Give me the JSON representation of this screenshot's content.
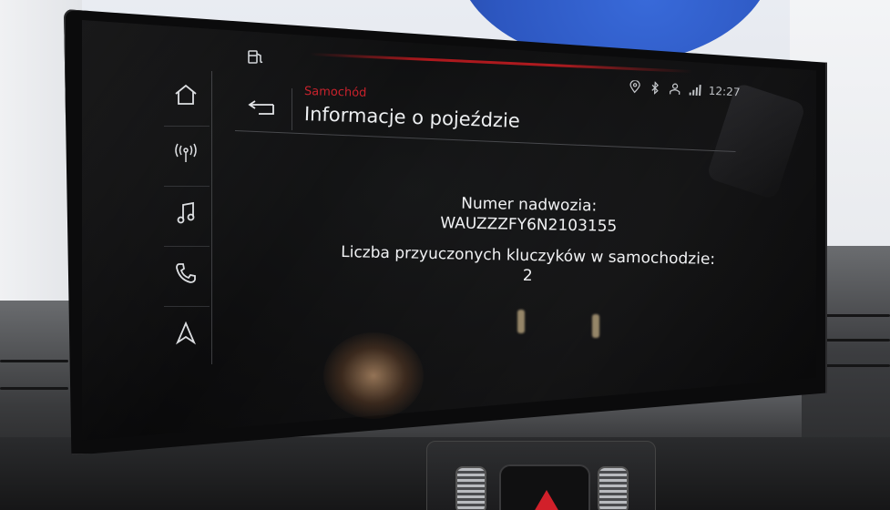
{
  "status": {
    "time": "12:27"
  },
  "header": {
    "breadcrumb": "Samochód",
    "title": "Informacje o pojeździe"
  },
  "vehicle_info": {
    "vin_label": "Numer nadwozia:",
    "vin_value": "WAUZZZFY6N2103155",
    "keys_label": "Liczba przyuczonych kluczyków w samochodzie:",
    "keys_value": "2"
  },
  "sidebar": {
    "items": [
      {
        "icon": "home-icon"
      },
      {
        "icon": "radio-antenna-icon"
      },
      {
        "icon": "music-note-icon"
      },
      {
        "icon": "phone-icon"
      },
      {
        "icon": "navigation-arrow-icon"
      }
    ]
  },
  "colors": {
    "accent": "#c8202a",
    "screen_bg": "#0d0d0e",
    "text": "#eceef0"
  }
}
